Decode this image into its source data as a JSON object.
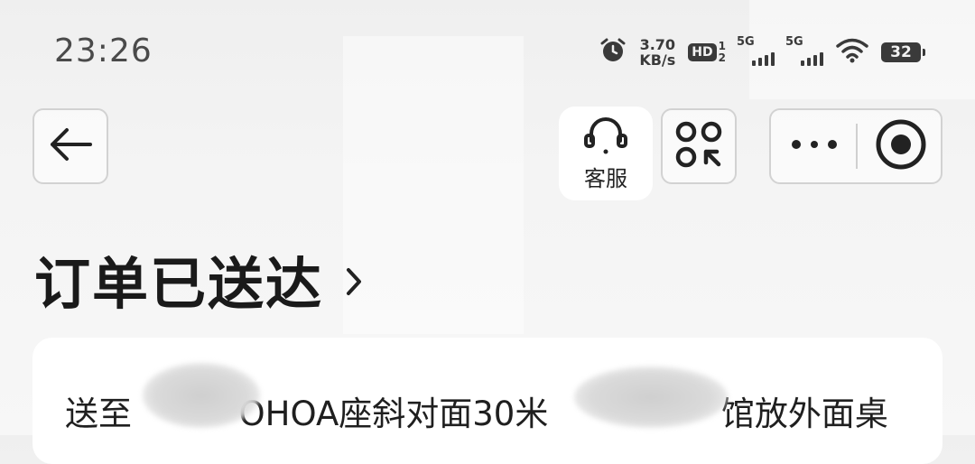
{
  "status_bar": {
    "time": "23:26",
    "net_speed_value": "3.70",
    "net_speed_unit": "KB/s",
    "hd_label": "HD",
    "hd_sub_top": "1",
    "hd_sub_bottom": "2",
    "sim1_label": "5G",
    "sim2_label": "5G",
    "battery": "32"
  },
  "nav": {
    "service_label": "客服"
  },
  "page": {
    "title": "订单已送达"
  },
  "card": {
    "address_prefix": "送至",
    "address_mid": "OHOA座斜对面30米",
    "address_suffix": "馆放外面桌"
  },
  "colors": {
    "background": "#f2f2f2",
    "text_dark": "#1a1a1a",
    "status_text": "#4a4a4a",
    "card": "#ffffff"
  }
}
